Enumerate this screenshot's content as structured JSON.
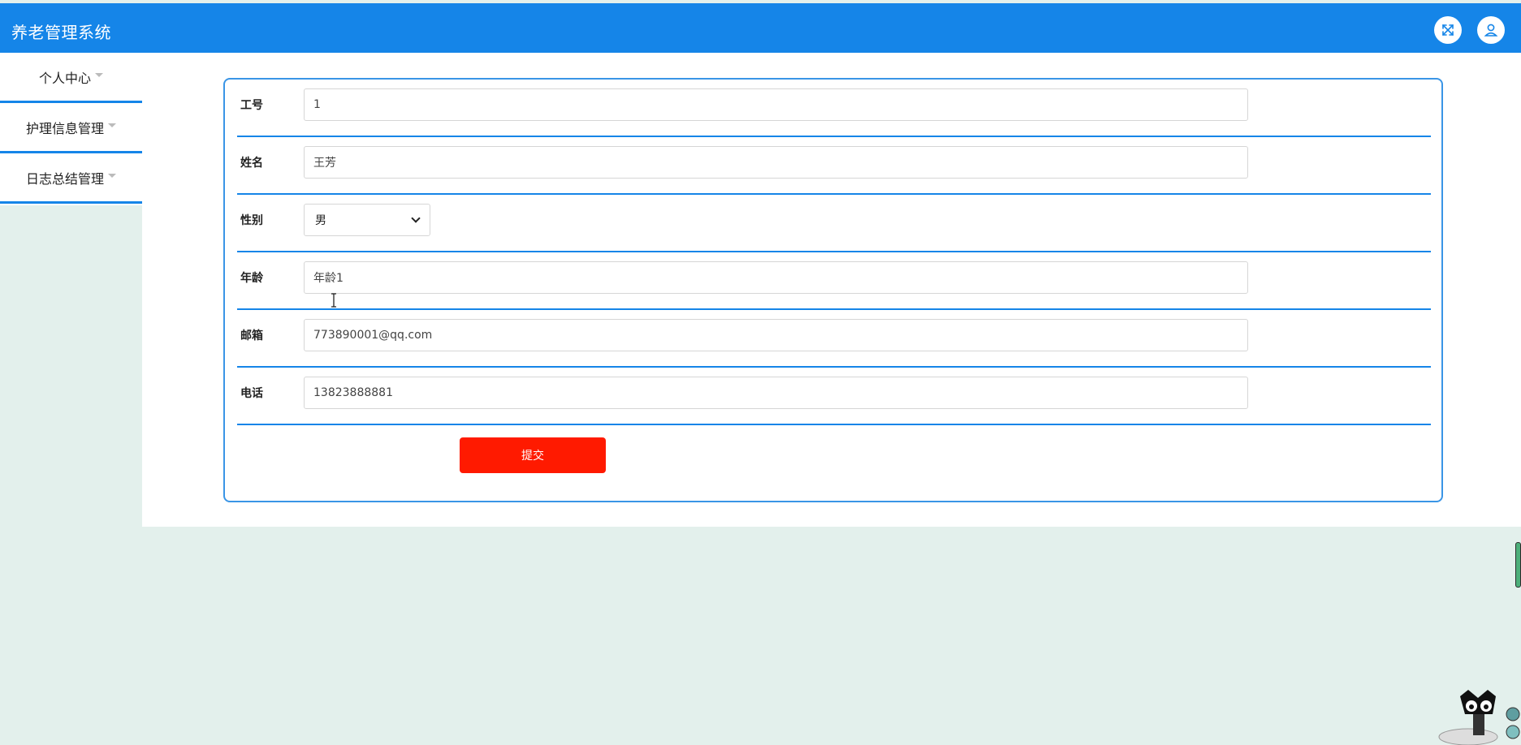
{
  "app": {
    "title": "养老管理系统"
  },
  "header": {
    "fullscreen_icon": "fullscreen-icon",
    "user_icon": "user-icon"
  },
  "sidebar": {
    "items": [
      {
        "label": "个人中心"
      },
      {
        "label": "护理信息管理"
      },
      {
        "label": "日志总结管理"
      }
    ]
  },
  "form": {
    "fields": [
      {
        "label": "工号",
        "value": "1"
      },
      {
        "label": "姓名",
        "value": "王芳"
      },
      {
        "label": "性别",
        "value": "男"
      },
      {
        "label": "年龄",
        "value": "年龄1"
      },
      {
        "label": "邮箱",
        "value": "773890001@qq.com"
      },
      {
        "label": "电话",
        "value": "13823888881"
      }
    ],
    "submit_label": "提交"
  },
  "colors": {
    "header": "#1585e8",
    "accent_border": "#3a95e6",
    "submit": "#ff1a00",
    "page_bg": "#e3f0ec"
  }
}
